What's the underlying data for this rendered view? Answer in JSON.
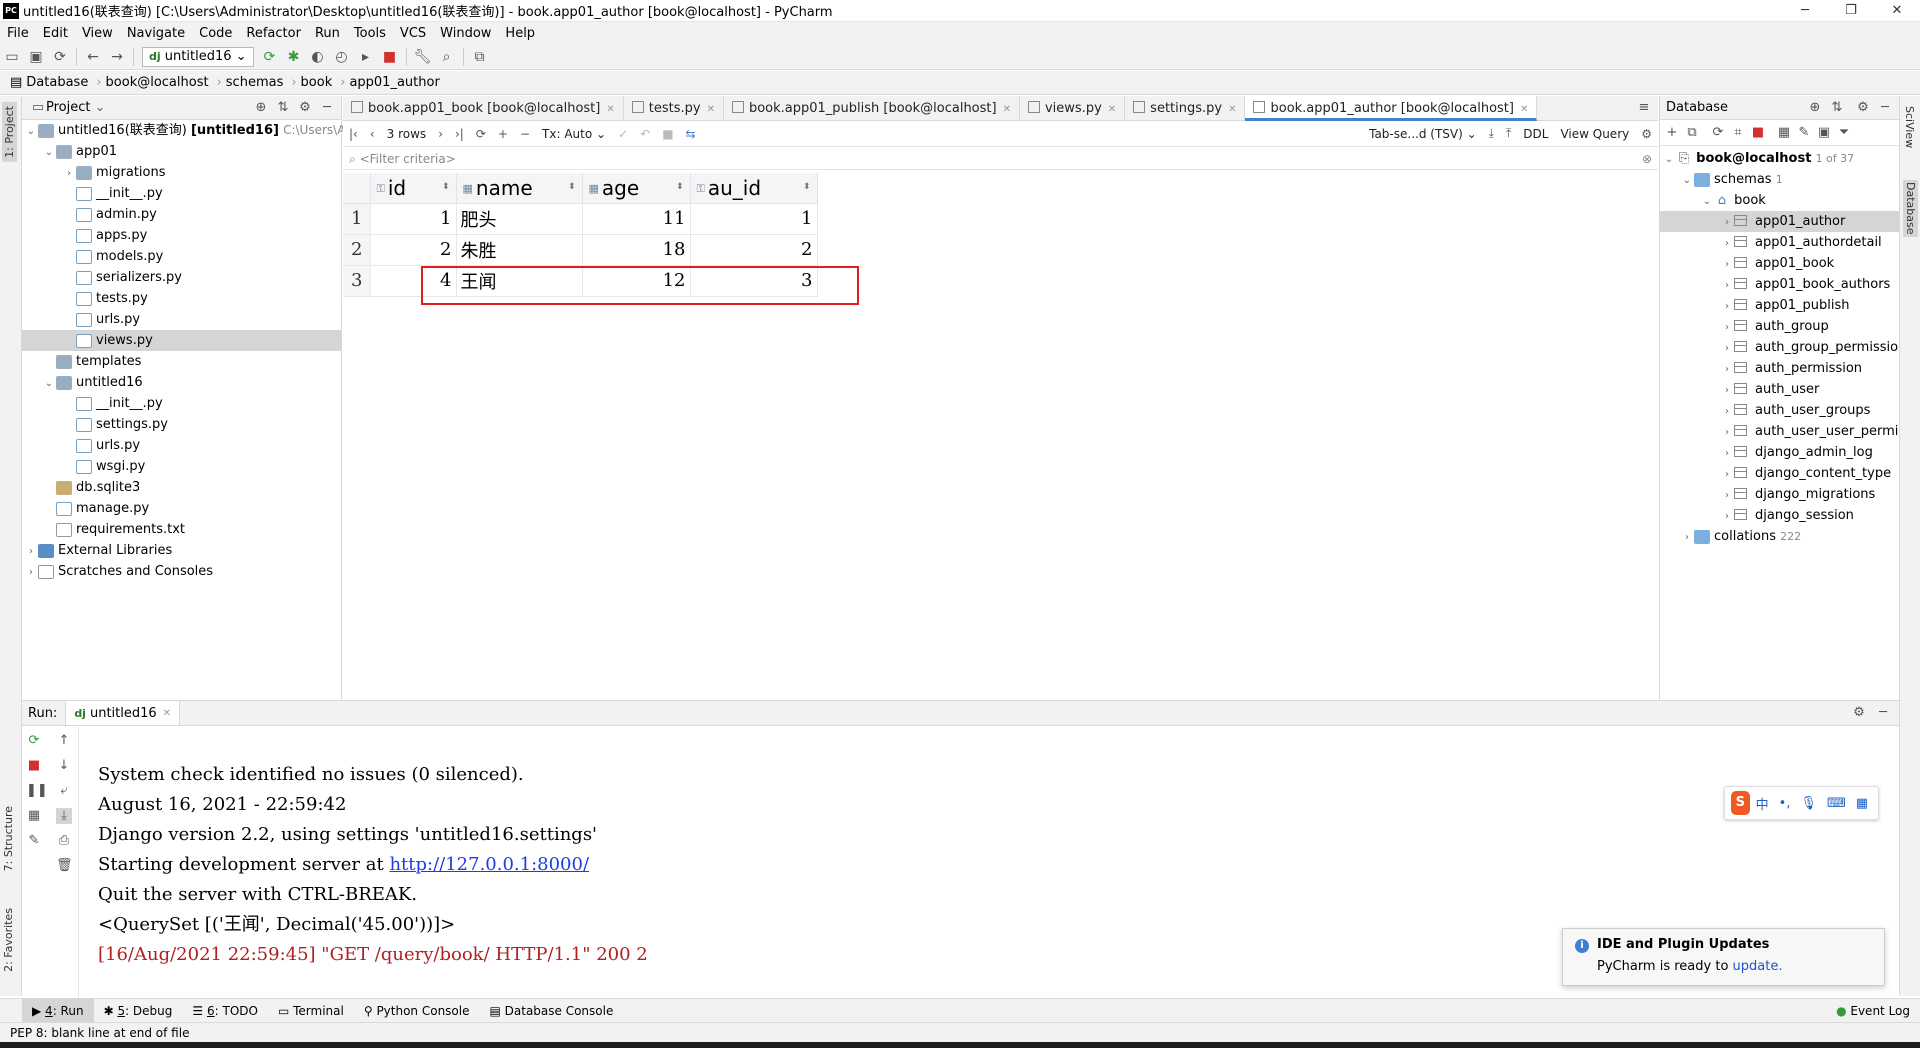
{
  "window": {
    "title": "untitled16(联表查询) [C:\\Users\\Administrator\\Desktop\\untitled16(联表查询)] - book.app01_author [book@localhost] - PyCharm",
    "logo_text": "PC"
  },
  "menu": [
    "File",
    "Edit",
    "View",
    "Navigate",
    "Code",
    "Refactor",
    "Run",
    "Tools",
    "VCS",
    "Window",
    "Help"
  ],
  "toolbar": {
    "run_config": "untitled16"
  },
  "breadcrumb": [
    "Database",
    "book@localhost",
    "schemas",
    "book",
    "app01_author"
  ],
  "left_stripe": {
    "project": "1: Project",
    "structure": "7: Structure",
    "favorites": "2: Favorites"
  },
  "right_stripe": {
    "sciview": "SciView",
    "database": "Database"
  },
  "project": {
    "header": "Project",
    "root_label": "untitled16(联表查询)",
    "root_bold": "[untitled16]",
    "root_path": "C:\\Users\\Admi",
    "items": [
      {
        "label": "app01"
      },
      {
        "label": "migrations"
      },
      {
        "label": "__init__.py"
      },
      {
        "label": "admin.py"
      },
      {
        "label": "apps.py"
      },
      {
        "label": "models.py"
      },
      {
        "label": "serializers.py"
      },
      {
        "label": "tests.py"
      },
      {
        "label": "urls.py"
      },
      {
        "label": "views.py"
      },
      {
        "label": "templates"
      },
      {
        "label": "untitled16"
      },
      {
        "label": "__init__.py"
      },
      {
        "label": "settings.py"
      },
      {
        "label": "urls.py"
      },
      {
        "label": "wsgi.py"
      },
      {
        "label": "db.sqlite3"
      },
      {
        "label": "manage.py"
      },
      {
        "label": "requirements.txt"
      },
      {
        "label": "External Libraries"
      },
      {
        "label": "Scratches and Consoles"
      }
    ]
  },
  "tabs": [
    {
      "label": "book.app01_book [book@localhost]"
    },
    {
      "label": "tests.py"
    },
    {
      "label": "book.app01_publish [book@localhost]"
    },
    {
      "label": "views.py"
    },
    {
      "label": "settings.py"
    },
    {
      "label": "book.app01_author [book@localhost]"
    }
  ],
  "grid_toolbar": {
    "rows": "3 rows",
    "tx": "Tx: Auto",
    "format": "Tab-se...d (TSV)",
    "ddl": "DDL",
    "view_query": "View Query"
  },
  "filter_placeholder": "<Filter criteria>",
  "table": {
    "columns": [
      "id",
      "name",
      "age",
      "au_id"
    ],
    "rows": [
      {
        "n": "1",
        "id": "1",
        "name": "肥头",
        "age": "11",
        "au_id": "1"
      },
      {
        "n": "2",
        "id": "2",
        "name": "朱胜",
        "age": "18",
        "au_id": "2"
      },
      {
        "n": "3",
        "id": "4",
        "name": "王闻",
        "age": "12",
        "au_id": "3"
      }
    ]
  },
  "database": {
    "header": "Database",
    "connection": "book@localhost",
    "connection_count": "1 of 37",
    "schemas": "schemas",
    "schemas_count": "1",
    "schema": "book",
    "tables": [
      "app01_author",
      "app01_authordetail",
      "app01_book",
      "app01_book_authors",
      "app01_publish",
      "auth_group",
      "auth_group_permissions",
      "auth_permission",
      "auth_user",
      "auth_user_groups",
      "auth_user_user_permiss",
      "django_admin_log",
      "django_content_type",
      "django_migrations",
      "django_session"
    ],
    "collations": "collations",
    "collations_count": "222"
  },
  "run": {
    "label": "Run:",
    "config": "untitled16",
    "lines": [
      "System check identified no issues (0 silenced).",
      "August 16, 2021 - 22:59:42",
      "Django version 2.2, using settings 'untitled16.settings'",
      "Starting development server at ",
      "Quit the server with CTRL-BREAK.",
      "<QuerySet [('王闻', Decimal('45.00'))]>",
      "[16/Aug/2021 22:59:45] \"GET /query/book/ HTTP/1.1\" 200 2"
    ],
    "link": "http://127.0.0.1:8000/"
  },
  "ime": {
    "logo": "S",
    "mode": "中"
  },
  "notification": {
    "title": "IDE and Plugin Updates",
    "body": "PyCharm is ready to ",
    "link": "update."
  },
  "bottom_tabs": [
    {
      "num": "4",
      "label": ": Run"
    },
    {
      "num": "5",
      "label": ": Debug"
    },
    {
      "num": "6",
      "label": ": TODO"
    },
    {
      "num": "",
      "label": "Terminal"
    },
    {
      "num": "",
      "label": "Python Console"
    },
    {
      "num": "",
      "label": "Database Console"
    }
  ],
  "event_log": "Event Log",
  "status": "PEP 8: blank line at end of file",
  "colors": {
    "accent": "#4083c9",
    "highlight_box": "#e02020",
    "link": "#1c3de6",
    "log_red": "#b02020"
  }
}
